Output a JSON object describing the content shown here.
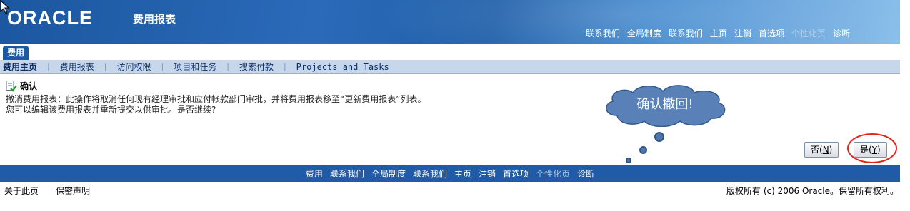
{
  "header": {
    "logo": "ORACLE",
    "app_title": "费用报表",
    "nav": [
      {
        "label": "联系我们",
        "dim": false
      },
      {
        "label": "全局制度",
        "dim": false
      },
      {
        "label": "联系我们",
        "dim": false
      },
      {
        "label": "主页",
        "dim": false
      },
      {
        "label": "注销",
        "dim": false
      },
      {
        "label": "首选项",
        "dim": false
      },
      {
        "label": "个性化页",
        "dim": true
      },
      {
        "label": "诊断",
        "dim": false
      }
    ]
  },
  "tab": {
    "label": "费用"
  },
  "subnav": {
    "items": [
      "费用主页",
      "费用报表",
      "访问权限",
      "项目和任务",
      "搜索付款",
      "Projects and Tasks"
    ]
  },
  "confirm": {
    "title": "确认",
    "message": "撤消费用报表：此操作将取消任何现有经理审批和应付帐款部门审批，并将费用报表移至“更新费用报表”列表。您可以编辑该费用报表并重新提交以供审批。是否继续?"
  },
  "callout": {
    "text": "确认撤回!"
  },
  "buttons": {
    "no_label": "否(",
    "no_key": "N",
    "yes_label": "是(",
    "yes_key": "Y",
    "close": ")"
  },
  "footer": {
    "nav": [
      {
        "label": "费用",
        "dim": false
      },
      {
        "label": "联系我们",
        "dim": false
      },
      {
        "label": "全局制度",
        "dim": false
      },
      {
        "label": "联系我们",
        "dim": false
      },
      {
        "label": "主页",
        "dim": false
      },
      {
        "label": "注销",
        "dim": false
      },
      {
        "label": "首选项",
        "dim": false
      },
      {
        "label": "个性化页",
        "dim": true
      },
      {
        "label": "诊断",
        "dim": false
      }
    ],
    "about": "关于此页",
    "privacy": "保密声明",
    "copyright": "版权所有 (c) 2006 Oracle。保留所有权利。"
  },
  "colors": {
    "header": "#1f5fa9",
    "subnav": "#c7d7eb",
    "footer": "#1f5ba6",
    "highlight": "#e2231a",
    "callout": "#5a80b8"
  }
}
